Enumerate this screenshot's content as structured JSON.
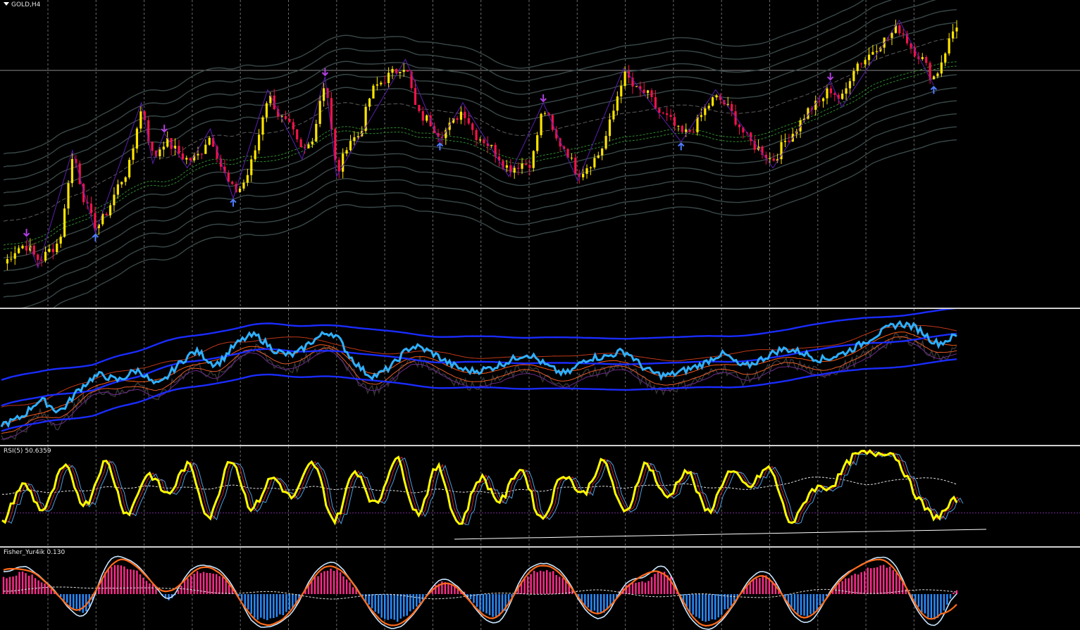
{
  "colors": {
    "background": "#000000",
    "grid": "#6b6b6b",
    "separator": "#cfcfcf",
    "bull_candle": "#ffe400",
    "bear_candle": "#f0144a",
    "zigzag": "#5a1fb0",
    "fractal_up": "#4f7cff",
    "fractal_down": "#b040e0",
    "bands": "#3a4848",
    "ma_green": "#2f8a2f",
    "main_blue": "#2fb0ff",
    "env_blue": "#1a2cff",
    "rsi_main": "#ffff00",
    "fisher_pos": "#ff2c8a",
    "fisher_neg": "#2a8cff",
    "fisher_line": "#ff6a1a",
    "fisher_signal": "#c8e6ff"
  },
  "main": {
    "symbol_label": "GOLD,H4",
    "menu_icon": "triangle-down-icon",
    "level_line_value": 1.0
  },
  "panes": {
    "osc": {
      "label": ""
    },
    "rsi": {
      "label": "RSI(5)",
      "value": "50.6359"
    },
    "fisher": {
      "label": "Fisher_Yur4ik",
      "value": "0.130"
    }
  },
  "chart_data": [
    {
      "type": "candlestick",
      "title": "GOLD,H4",
      "series": [
        {
          "name": "price",
          "values": [
            0.1,
            0.16,
            0.18,
            0.12,
            0.16,
            0.24,
            0.58,
            0.4,
            0.28,
            0.34,
            0.46,
            0.56,
            0.8,
            0.6,
            0.66,
            0.62,
            0.58,
            0.6,
            0.68,
            0.54,
            0.44,
            0.48,
            0.64,
            0.86,
            0.78,
            0.72,
            0.62,
            0.7,
            0.92,
            0.54,
            0.66,
            0.7,
            0.88,
            0.94,
            0.98,
            1.0,
            0.8,
            0.76,
            0.7,
            0.74,
            0.8,
            0.7,
            0.66,
            0.6,
            0.54,
            0.56,
            0.58,
            0.8,
            0.68,
            0.62,
            0.52,
            0.56,
            0.62,
            0.78,
            0.96,
            0.9,
            0.88,
            0.8,
            0.76,
            0.7,
            0.72,
            0.8,
            0.86,
            0.82,
            0.74,
            0.66,
            0.62,
            0.58,
            0.66,
            0.72,
            0.8,
            0.84,
            0.9,
            0.86,
            1.0,
            1.04,
            1.1,
            1.14,
            1.18,
            1.1,
            1.04,
            0.96,
            1.08,
            1.2
          ]
        }
      ],
      "annotations": [
        "fractal up arrows",
        "fractal down arrows",
        "zigzag line",
        "envelope bands"
      ]
    },
    {
      "type": "line",
      "series": [
        {
          "name": "",
          "values": [
            0.1,
            0.16,
            0.3,
            0.22,
            0.4,
            0.52,
            0.48,
            0.56,
            0.44,
            0.6,
            0.72,
            0.62,
            0.78,
            0.86,
            0.74,
            0.7,
            0.82,
            0.88,
            0.66,
            0.52,
            0.6,
            0.76,
            0.72,
            0.62,
            0.56,
            0.58,
            0.64,
            0.7,
            0.6,
            0.54,
            0.66,
            0.68,
            0.72,
            0.58,
            0.52,
            0.56,
            0.62,
            0.7,
            0.6,
            0.66,
            0.74,
            0.72,
            0.66,
            0.7,
            0.78,
            0.88,
            0.96,
            0.92,
            0.8,
            0.86
          ]
        }
      ]
    },
    {
      "type": "line",
      "title": "RSI(5) 50.6359",
      "series": [
        {
          "name": "RSI(5)",
          "values": [
            0.18,
            0.62,
            0.34,
            0.82,
            0.4,
            0.88,
            0.3,
            0.74,
            0.52,
            0.84,
            0.26,
            0.92,
            0.36,
            0.7,
            0.48,
            0.86,
            0.22,
            0.78,
            0.4,
            0.92,
            0.3,
            0.82,
            0.18,
            0.7,
            0.44,
            0.8,
            0.24,
            0.74,
            0.52,
            0.88,
            0.3,
            0.86,
            0.48,
            0.78,
            0.32,
            0.76,
            0.6,
            0.8,
            0.2,
            0.56,
            0.62,
            0.94,
            0.98,
            0.96,
            0.52,
            0.26,
            0.46
          ]
        }
      ]
    },
    {
      "type": "bar",
      "title": "Fisher_Yur4ik 0.130",
      "series": [
        {
          "name": "Fisher_Yur4ik",
          "values": [
            0.6,
            0.8,
            0.4,
            -0.3,
            -0.6,
            0.9,
            1.0,
            0.5,
            -0.2,
            0.7,
            0.8,
            0.3,
            -0.8,
            -0.9,
            -0.5,
            0.6,
            0.9,
            0.2,
            -0.7,
            -1.0,
            -0.4,
            0.4,
            0.2,
            -0.6,
            -0.8,
            0.5,
            0.9,
            0.6,
            -0.4,
            -0.7,
            0.3,
            0.5,
            0.8,
            -0.6,
            -1.0,
            -0.5,
            0.4,
            0.6,
            -0.5,
            -0.8,
            0.2,
            0.7,
            1.0,
            0.9,
            -0.4,
            -0.9,
            0.13
          ]
        }
      ]
    }
  ]
}
